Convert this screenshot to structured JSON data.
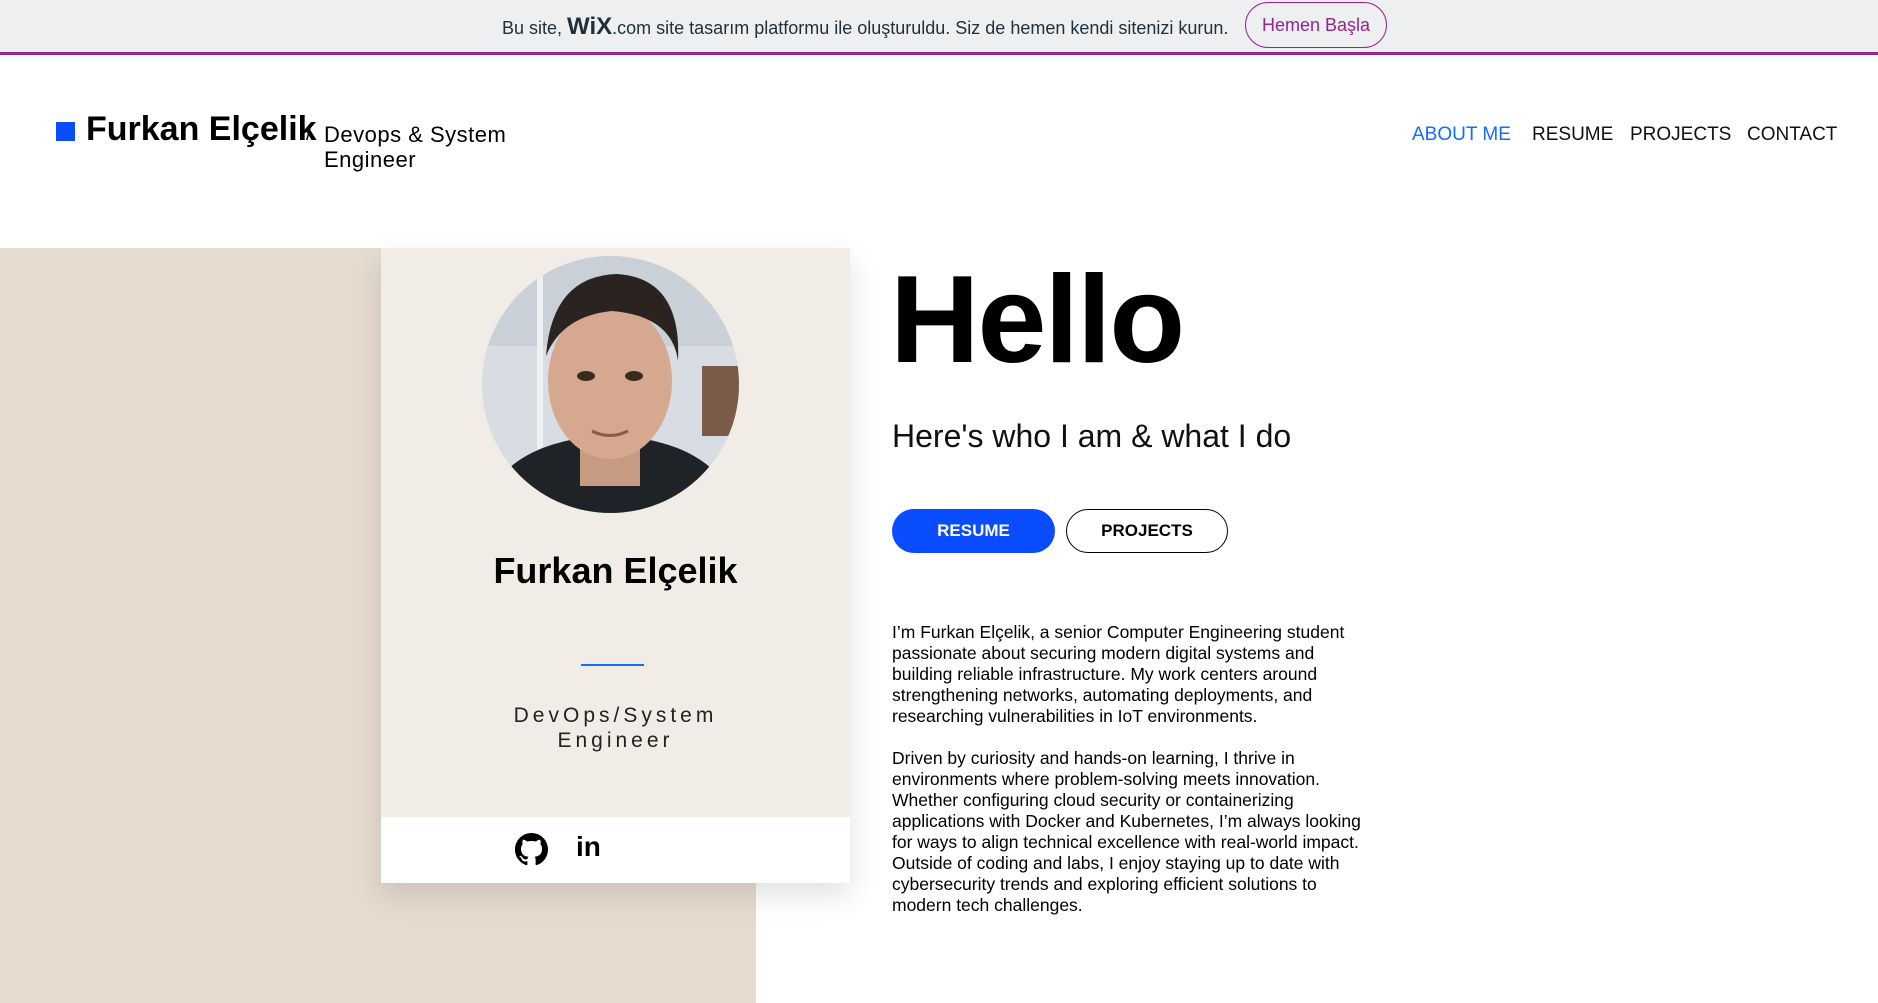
{
  "banner": {
    "text_before": "Bu site, ",
    "logo": "WiX",
    "text_after": ".com site tasarım platformu ile oluşturuldu. Siz de hemen kendi sitenizi kurun.",
    "cta": "Hemen Başla",
    "accent": "#93268f"
  },
  "header": {
    "name": "Furkan Elçelik",
    "slash": "/",
    "tagline": "Devops & System Engineer",
    "nav": [
      "ABOUT ME",
      "RESUME",
      "PROJECTS",
      "CONTACT"
    ],
    "active_nav": "ABOUT ME",
    "accent": "#116dff"
  },
  "card": {
    "name": "Furkan Elçelik",
    "role": "DevOps/System Engineer",
    "social": [
      "github-icon",
      "linkedin-icon"
    ],
    "linkedin_glyph": "in"
  },
  "hero": {
    "title": "Hello",
    "subtitle": "Here's who I am & what I do",
    "buttons": [
      "RESUME",
      "PROJECTS"
    ],
    "bio": [
      "I’m Furkan Elçelik, a senior Computer Engineering student passionate about securing modern digital systems and building reliable infrastructure. My work centers around strengthening networks, automating deployments, and researching vulnerabilities in IoT environments.",
      "Driven by curiosity and hands-on learning, I thrive in environments where problem-solving meets innovation. Whether configuring cloud security or containerizing applications with Docker and Kubernetes, I’m always looking for ways to align technical excellence with real-world impact. Outside of coding and labs, I enjoy staying up to date with cybersecurity trends and exploring efficient solutions to modern tech challenges."
    ]
  }
}
